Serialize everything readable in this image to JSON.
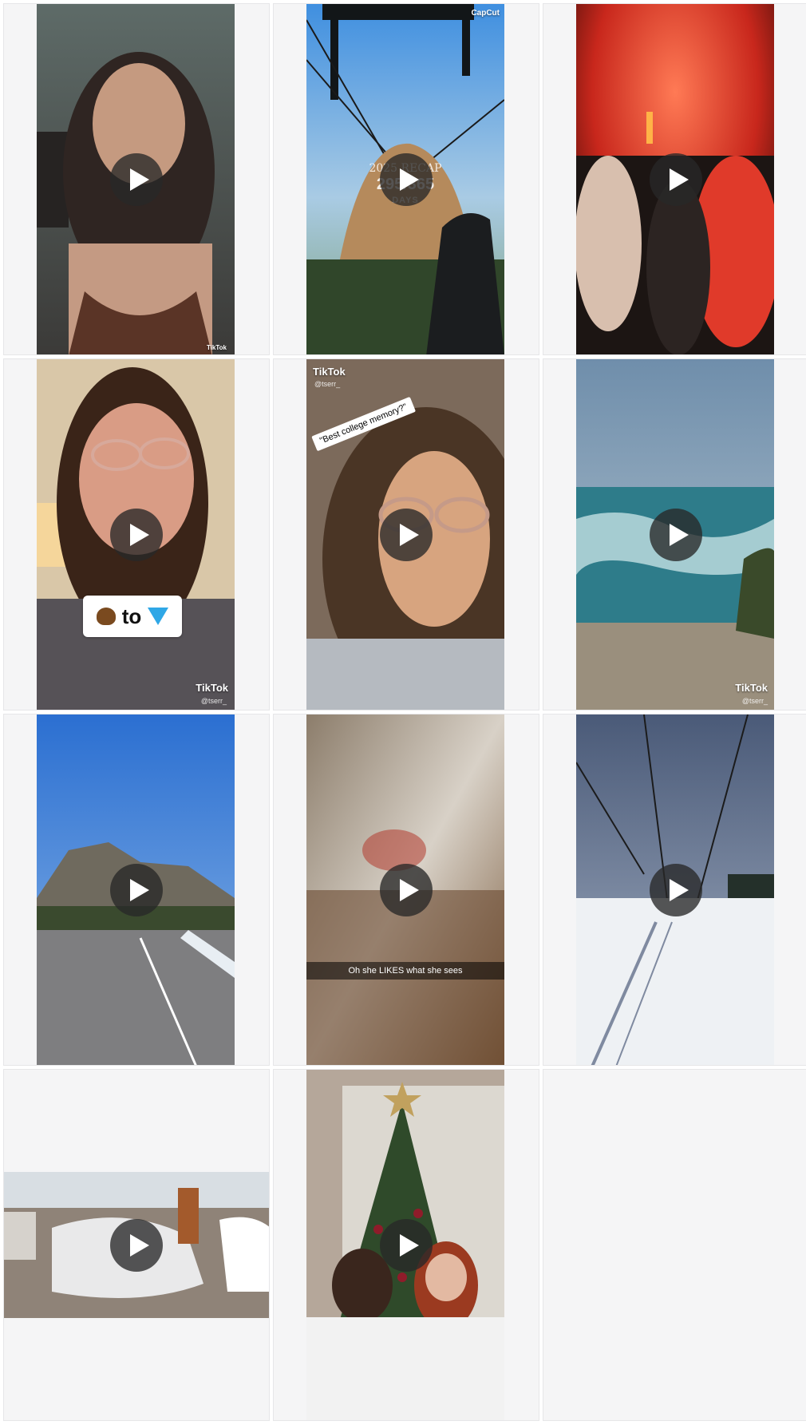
{
  "feed": {
    "tiles": [
      {
        "type": "video",
        "watermark": "TikTok"
      },
      {
        "type": "video",
        "watermark": "CapCut",
        "overlay": {
          "title": "2025 RECAP",
          "count": "295/365",
          "unit": "DAYS"
        }
      },
      {
        "type": "video"
      },
      {
        "type": "video",
        "watermark": "TikTok",
        "handle": "@tserr_",
        "overlay_text": "to"
      },
      {
        "type": "video",
        "watermark": "TikTok",
        "handle": "@tserr_",
        "overlay_text": "\"Best college memory?\""
      },
      {
        "type": "video",
        "watermark": "TikTok",
        "handle": "@tserr_"
      },
      {
        "type": "video"
      },
      {
        "type": "video",
        "caption": "Oh she LIKES what she sees"
      },
      {
        "type": "video"
      },
      {
        "type": "video"
      },
      {
        "type": "video"
      }
    ]
  },
  "colors": {
    "background": "#ffffff",
    "tile_background": "#f5f5f6",
    "play_button": "#282828",
    "play_icon": "#ffffff"
  },
  "icons": {
    "play": "play-icon",
    "tiktok": "tiktok-logo-icon",
    "capcut": "capcut-logo-icon",
    "user": "user-icon"
  }
}
